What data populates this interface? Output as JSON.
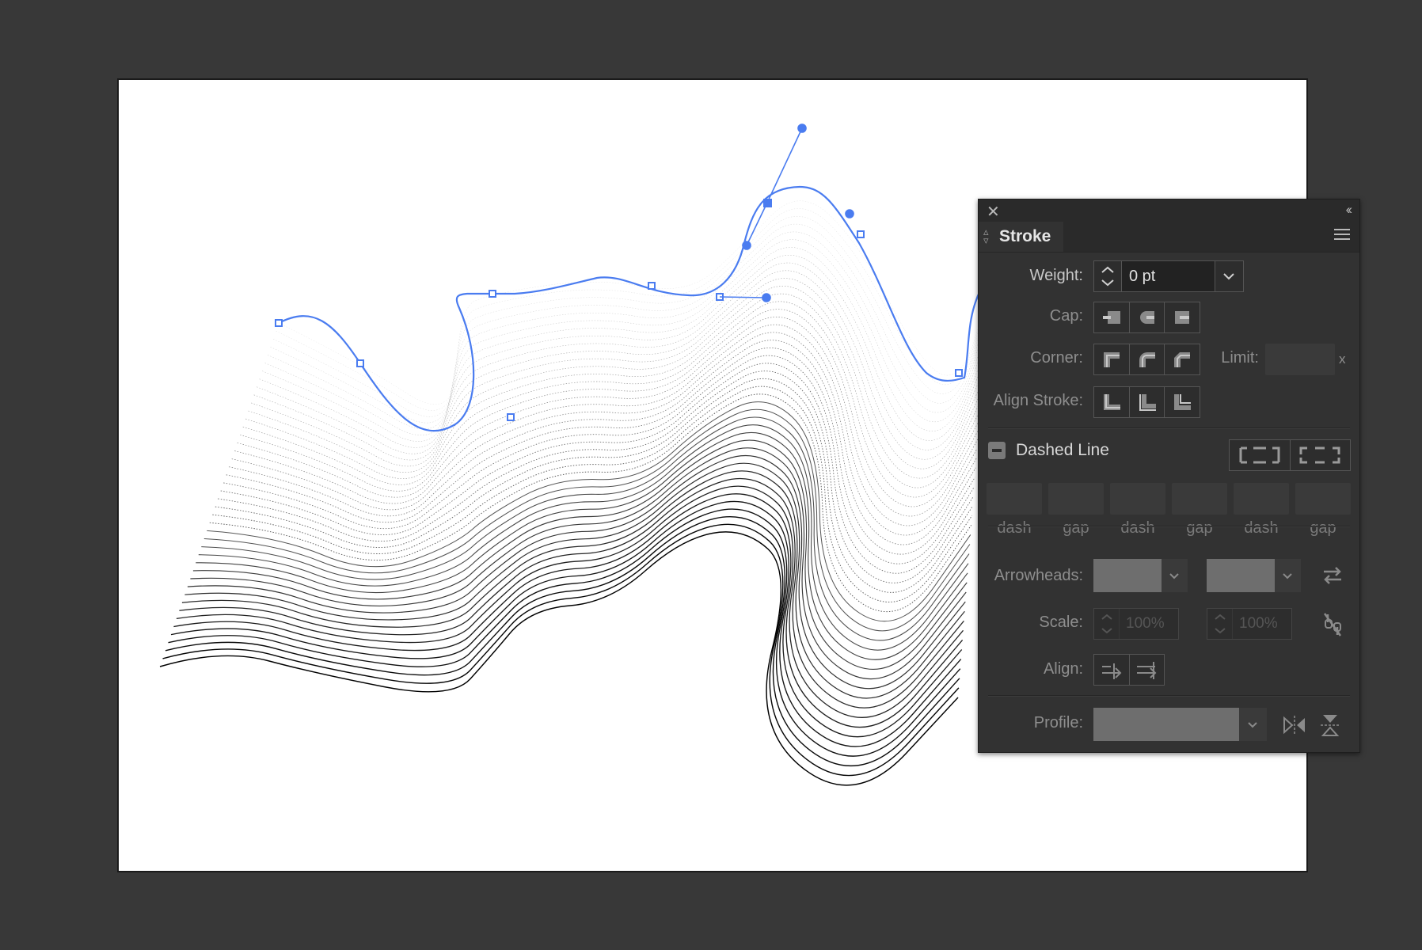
{
  "panel": {
    "title": "Stroke",
    "weight_label": "Weight:",
    "weight_value": "0 pt",
    "cap_label": "Cap:",
    "corner_label": "Corner:",
    "limit_label": "Limit:",
    "limit_unit": "x",
    "align_stroke_label": "Align Stroke:",
    "dashed_line_label": "Dashed Line",
    "dash_gap_labels": [
      "dash",
      "gap",
      "dash",
      "gap",
      "dash",
      "gap"
    ],
    "arrowheads_label": "Arrowheads:",
    "scale_label": "Scale:",
    "scale_start": "100%",
    "scale_end": "100%",
    "align_label": "Align:",
    "profile_label": "Profile:"
  },
  "colors": {
    "canvas_bg": "#383838",
    "artboard": "#ffffff",
    "path_selection": "#4a7cf0",
    "panel_bg": "#323232"
  }
}
